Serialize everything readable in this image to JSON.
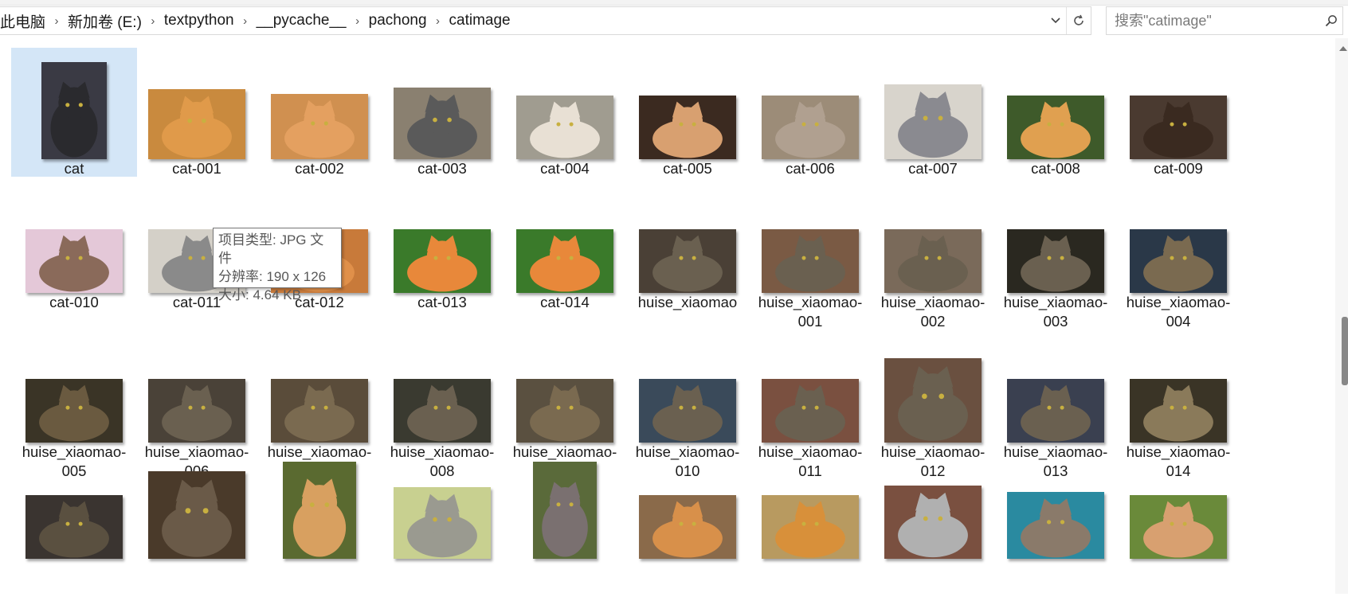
{
  "breadcrumb": {
    "items": [
      "此电脑",
      "新加卷 (E:)",
      "textpython",
      "__pycache__",
      "pachong",
      "catimage"
    ],
    "separator": "›"
  },
  "search": {
    "placeholder": "搜索\"catimage\""
  },
  "tooltip": {
    "type": "项目类型: JPG 文件",
    "resolution": "分辨率: 190 x 126",
    "size": "大小: 4.64 KB"
  },
  "files": [
    "cat",
    "cat-001",
    "cat-002",
    "cat-003",
    "cat-004",
    "cat-005",
    "cat-006",
    "cat-007",
    "cat-008",
    "cat-009",
    "cat-010",
    "cat-011",
    "cat-012",
    "cat-013",
    "cat-014",
    "huise_xiaomao",
    "huise_xiaomao-\n001",
    "huise_xiaomao-\n002",
    "huise_xiaomao-\n003",
    "huise_xiaomao-\n004",
    "huise_xiaomao-\n005",
    "huise_xiaomao-\n006",
    "huise_xiaomao-\n007",
    "huise_xiaomao-\n008",
    "huise_xiaomao-\n009",
    "huise_xiaomao-\n010",
    "huise_xiaomao-\n011",
    "huise_xiaomao-\n012",
    "huise_xiaomao-\n013",
    "huise_xiaomao-\n014",
    "",
    "",
    "",
    "",
    "",
    "",
    "",
    "",
    "",
    ""
  ],
  "colors": {
    "selection": "#d4e6f7",
    "accent": "#0078d7"
  }
}
